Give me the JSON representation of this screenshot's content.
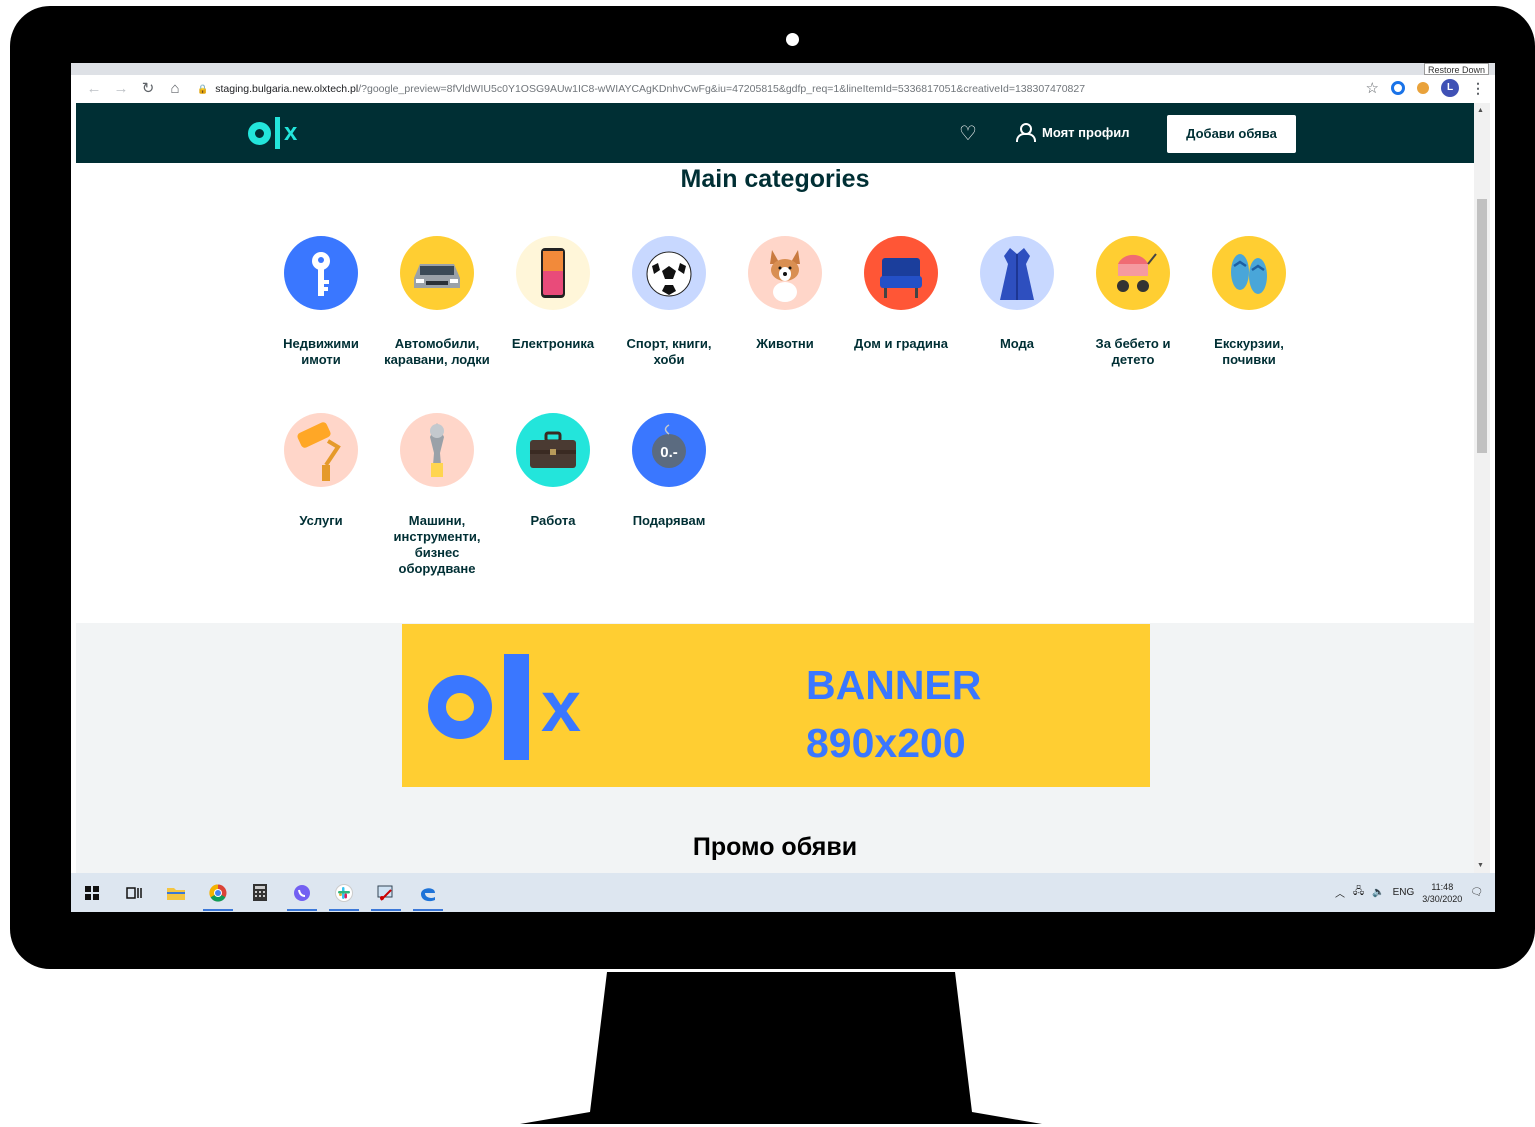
{
  "browser": {
    "url_host": "staging.bulgaria.new.olxtech.pl",
    "url_path": "/?google_preview=8fVldWIU5c0Y1OSG9AUw1IC8-wWIAYCAgKDnhvCwFg&iu=47205815&gdfp_req=1&lineItemId=5336817051&creativeId=138307470827",
    "restore_tooltip": "Restore Down",
    "profile_initial": "L"
  },
  "header": {
    "logo_x": "x",
    "profile_label": "Моят профил",
    "post_button_label": "Добави обява"
  },
  "main": {
    "title": "Main categories",
    "categories": [
      {
        "label": "Недвижими имоти",
        "icon": "key-icon",
        "bg": "#3a77ff"
      },
      {
        "label": "Автомобили, каравани, лодки",
        "icon": "car-icon",
        "bg": "#ffce32"
      },
      {
        "label": "Електроника",
        "icon": "phone-icon",
        "bg": "#fff6d9"
      },
      {
        "label": "Спорт, книги, хоби",
        "icon": "soccer-ball-icon",
        "bg": "#c8d8ff"
      },
      {
        "label": "Животни",
        "icon": "dog-icon",
        "bg": "#ffd6c9"
      },
      {
        "label": "Дом и градина",
        "icon": "armchair-icon",
        "bg": "#ff5636"
      },
      {
        "label": "Мода",
        "icon": "dress-icon",
        "bg": "#c8d8ff"
      },
      {
        "label": "За бебето и детето",
        "icon": "stroller-icon",
        "bg": "#ffce32"
      },
      {
        "label": "Екскурзии, почивки",
        "icon": "flip-flops-icon",
        "bg": "#ffce32"
      },
      {
        "label": "Услуги",
        "icon": "paint-roller-icon",
        "bg": "#ffd6c9"
      },
      {
        "label": "Машини, инструменти, бизнес оборудване",
        "icon": "wrench-icon",
        "bg": "#ffd6c9"
      },
      {
        "label": "Работа",
        "icon": "briefcase-icon",
        "bg": "#23e5db"
      },
      {
        "label": "Подарявам",
        "icon": "price-tag-icon",
        "bg": "#3a77ff",
        "tag_text": "0.-"
      }
    ]
  },
  "banner": {
    "logo_x": "x",
    "line1": "BANNER",
    "line2": "890x200"
  },
  "promo": {
    "title": "Промо обяви"
  },
  "taskbar": {
    "lang": "ENG",
    "time": "11:48",
    "date": "3/30/2020"
  },
  "colors": {
    "header_bg": "#002f34",
    "accent_teal": "#23e5db",
    "banner_yellow": "#ffce32",
    "banner_blue": "#3a77ff"
  }
}
